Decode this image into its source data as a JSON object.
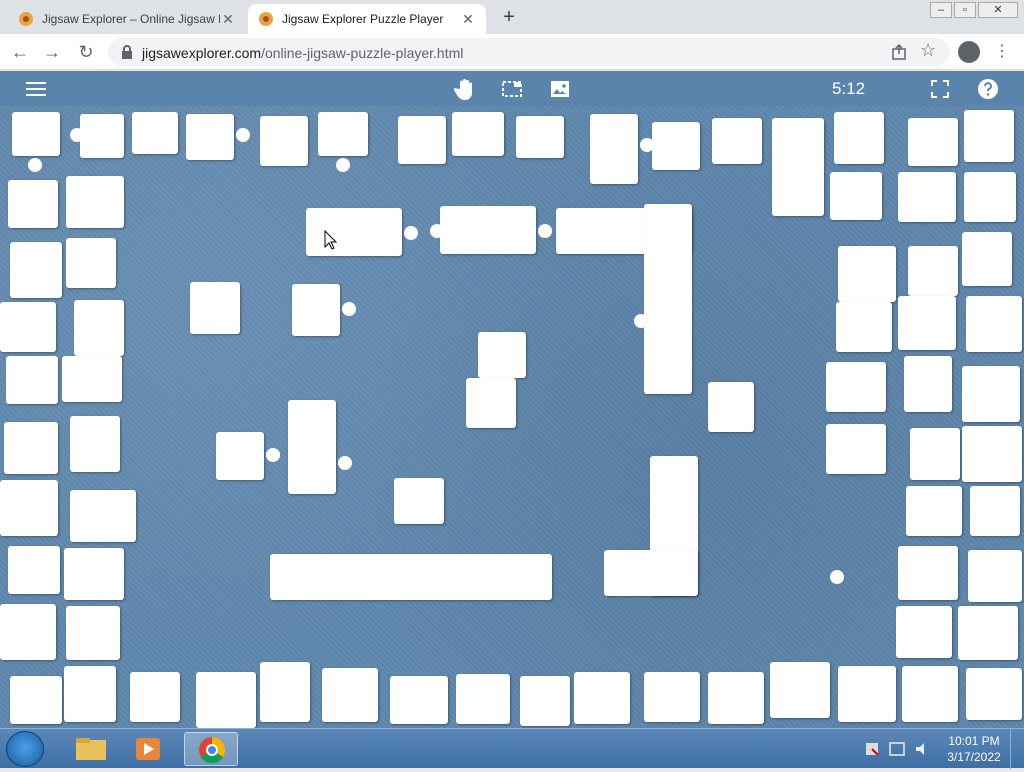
{
  "browser": {
    "tabs": [
      {
        "title": "Jigsaw Explorer – Online Jigsaw P",
        "active": false
      },
      {
        "title": "Jigsaw Explorer Puzzle Player",
        "active": true
      }
    ],
    "url_domain": "jigsawexplorer.com",
    "url_path": "/online-jigsaw-puzzle-player.html",
    "new_tab": "+",
    "tab_close": "✕"
  },
  "app": {
    "timer": "5:12",
    "icons": [
      "menu-icon",
      "hand-icon",
      "selection-icon",
      "image-icon",
      "fullscreen-icon",
      "help-icon"
    ]
  },
  "taskbar": {
    "time": "10:01 PM",
    "date": "3/17/2022",
    "pinned": [
      "file-explorer-icon",
      "media-player-icon",
      "chrome-icon"
    ]
  },
  "colors": {
    "board": "#5f87ad",
    "appbar": "#5b84ad",
    "piece": "#ffffff"
  }
}
